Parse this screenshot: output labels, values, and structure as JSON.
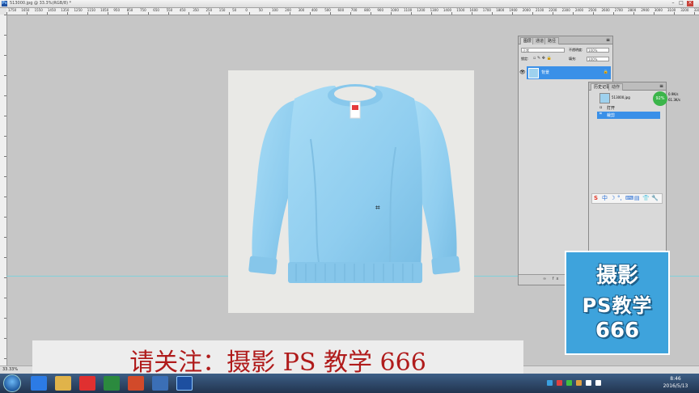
{
  "window": {
    "title": "513000.jpg @ 33.3%(RGB/8) *"
  },
  "ruler": {
    "ticks": [
      "1750",
      "1650",
      "1550",
      "1450",
      "1350",
      "1250",
      "1150",
      "1050",
      "950",
      "850",
      "750",
      "650",
      "550",
      "450",
      "350",
      "250",
      "150",
      "50",
      "0",
      "50",
      "100",
      "200",
      "300",
      "400",
      "500",
      "600",
      "700",
      "800",
      "900",
      "1000",
      "1100",
      "1200",
      "1300",
      "1400",
      "1500",
      "1600",
      "1700",
      "1800",
      "1900",
      "2000",
      "2100",
      "2200",
      "2300",
      "2400",
      "2500",
      "2600",
      "2700",
      "2800",
      "2900",
      "3000",
      "3100",
      "3200",
      "3300"
    ]
  },
  "layers_panel": {
    "tabs": [
      "图层",
      "通道",
      "路径"
    ],
    "blend_mode": "正常",
    "opacity_label": "不透明度:",
    "opacity_value": "100%",
    "lock_label": "锁定:",
    "fill_label": "填充:",
    "fill_value": "100%",
    "layer_name": "背景"
  },
  "history_panel": {
    "tabs": [
      "历史记录",
      "动作"
    ],
    "snapshot": "513000.jpg",
    "items": [
      "打开",
      "裁剪"
    ]
  },
  "net_meter": {
    "percent": "92%",
    "up": "0.9K/s",
    "down": "61.3K/s"
  },
  "sogou": {
    "label": "S",
    "items": [
      "中",
      "☽",
      "°,",
      "⌨",
      "▤",
      "👕",
      "🔧"
    ]
  },
  "logo": {
    "line1": "摄影",
    "line2": "PS教学",
    "line3": "666"
  },
  "banner": {
    "text": "请关注：摄影 PS 教学 666"
  },
  "status": {
    "zoom": "33.33%"
  },
  "taskbar": {
    "time": "8:46",
    "date": "2016/5/13"
  },
  "colors": {
    "sweater": "#8fcdef",
    "accent": "#3a90e8",
    "banner_text": "#b01b1b",
    "logo_bg": "#3ea3dc"
  }
}
